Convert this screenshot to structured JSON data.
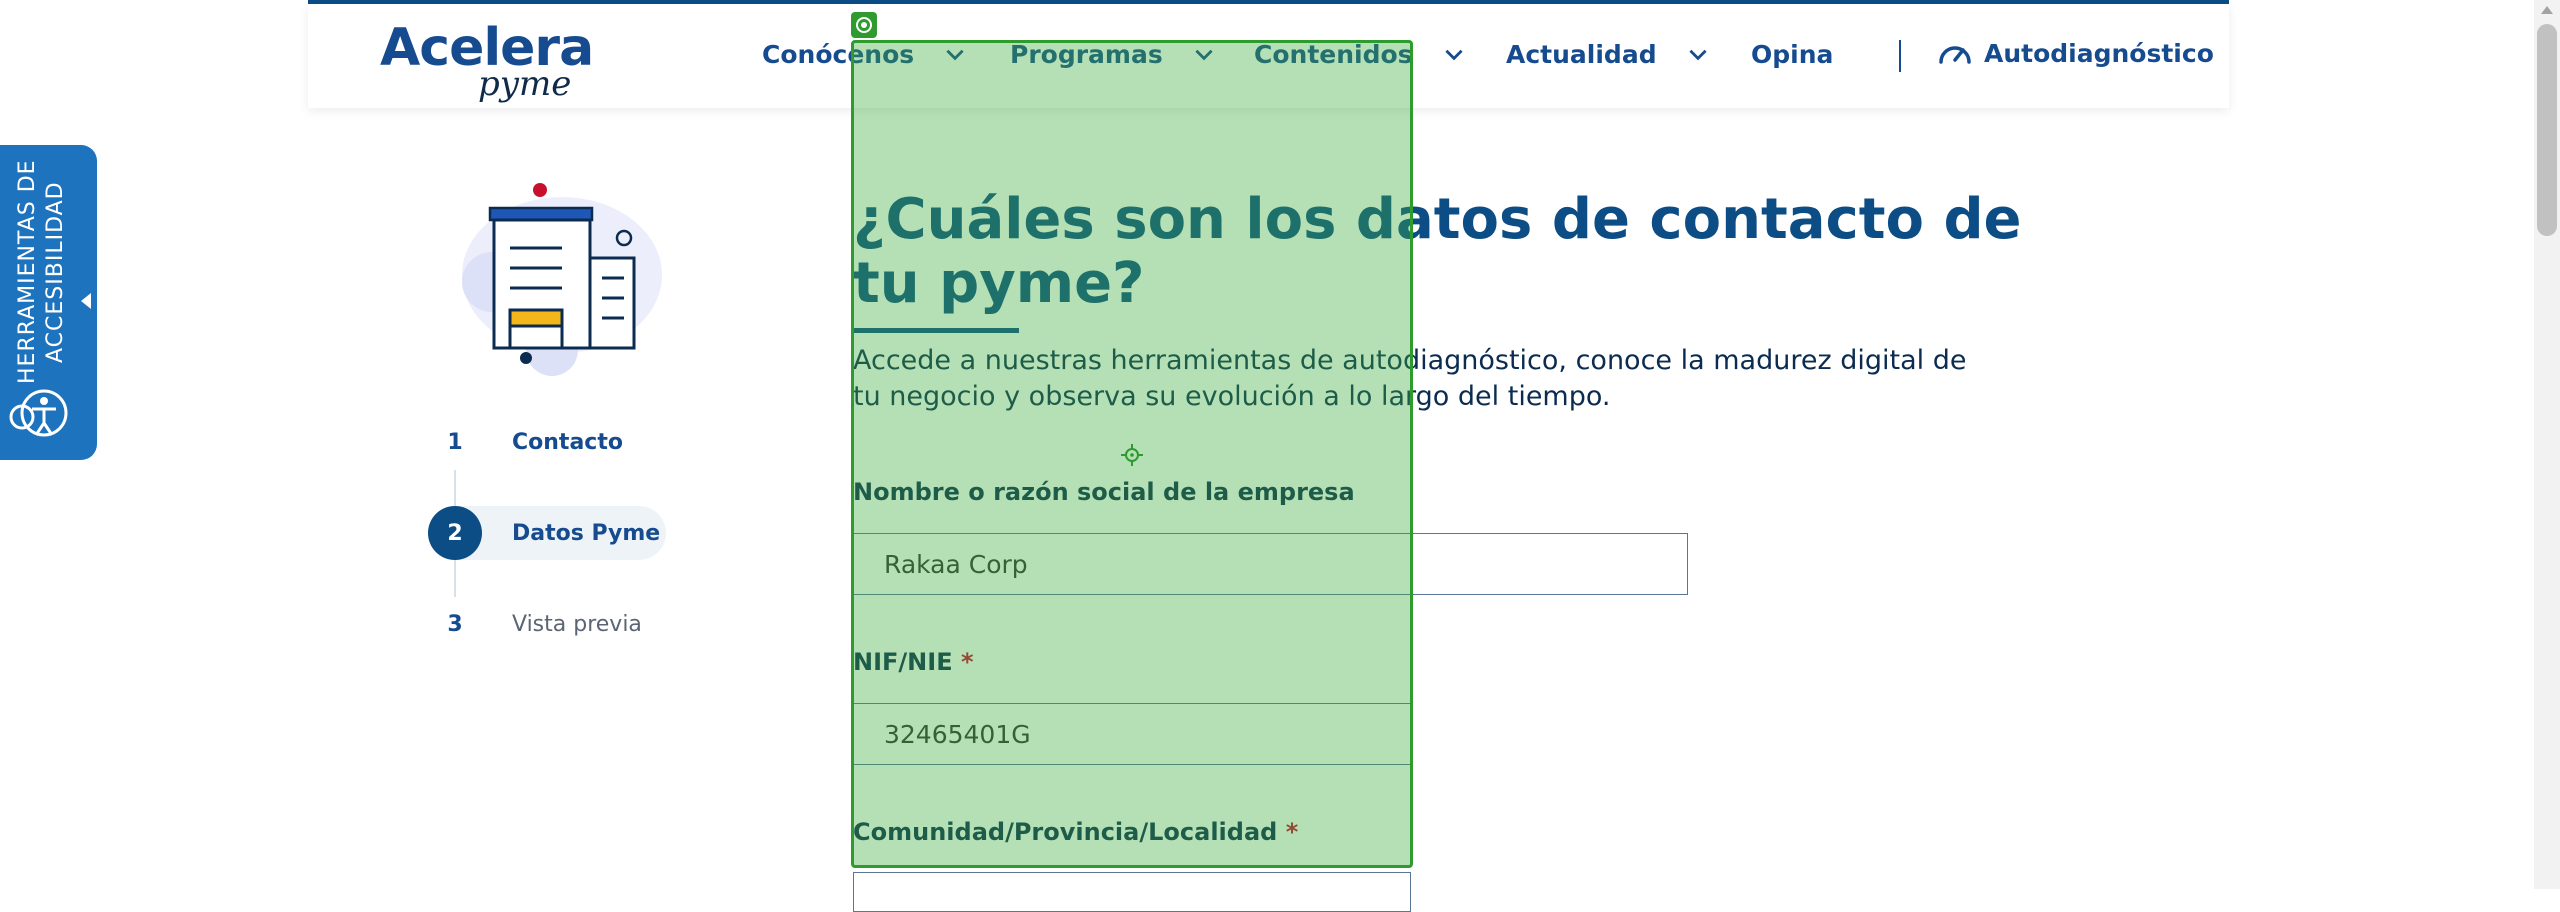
{
  "header": {
    "logo_main": "Acelera",
    "logo_sub": "pyme",
    "nav": [
      {
        "label": "Conócenos",
        "has_dropdown": true
      },
      {
        "label": "Programas",
        "has_dropdown": true
      },
      {
        "label": "Contenidos",
        "has_dropdown": true
      },
      {
        "label": "Actualidad",
        "has_dropdown": true
      },
      {
        "label": "Opina",
        "has_dropdown": false
      }
    ],
    "autodiag_label": "Autodiagnóstico"
  },
  "accessibility": {
    "label": "HERRAMIENTAS DE ACCESIBILIDAD"
  },
  "steps": [
    {
      "number": "1",
      "label": "Contacto",
      "state": "completed"
    },
    {
      "number": "2",
      "label": "Datos Pyme",
      "state": "active"
    },
    {
      "number": "3",
      "label": "Vista previa",
      "state": "pending"
    }
  ],
  "main": {
    "title": "¿Cuáles son los datos de contacto de tu pyme?",
    "subtitle": "Accede a nuestras herramientas de autodiagnóstico, conoce la madurez digital de tu negocio y observa su evolución a lo largo del tiempo.",
    "fields": {
      "company_name": {
        "label": "Nombre o razón social de la empresa",
        "value": "Rakaa Corp"
      },
      "nif": {
        "label": "NIF/NIE",
        "required_mark": "*",
        "value": "32465401G"
      },
      "location": {
        "label": "Comunidad/Provincia/Localidad",
        "required_mark": "*"
      }
    }
  },
  "colors": {
    "brand_blue": "#0c4d86",
    "accessibility_blue": "#1e73be",
    "required_red": "#c8102e",
    "overlay_green": "#2f9b2f"
  }
}
